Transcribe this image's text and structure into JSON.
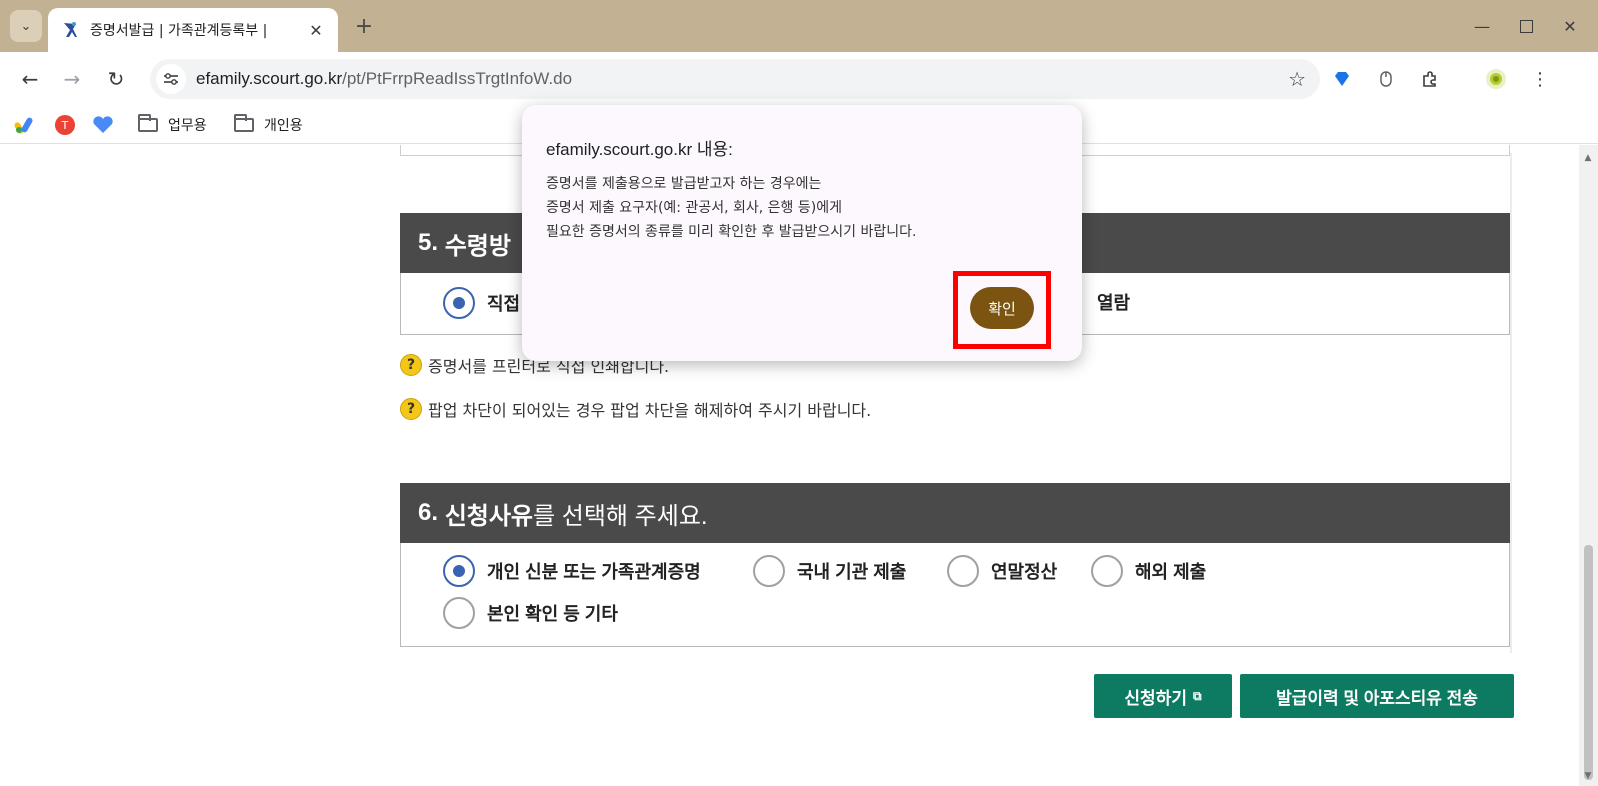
{
  "browser": {
    "tab_title": "증명서발급 | 가족관계등록부 |",
    "url_host": "efamily.scourt.go.kr",
    "url_path": "/pt/PtFrrpReadIssTrgtInfoW.do",
    "bookmarks": [
      "업무용",
      "개인용"
    ]
  },
  "section5": {
    "header_number": "5.",
    "header_bold": "수령방",
    "option_selected": "직접",
    "option_other": "열람"
  },
  "notes": [
    "증명서를 프린터로 직접 인쇄합니다.",
    "팝업 차단이 되어있는 경우 팝업 차단을 해제하여 주시기 바랍니다."
  ],
  "section6": {
    "header_number": "6.",
    "header_bold": "신청사유",
    "header_rest": "를 선택해 주세요.",
    "options": [
      "개인 신분 또는 가족관계증명",
      "국내 기관 제출",
      "연말정산",
      "해외 제출",
      "본인 확인 등 기타"
    ],
    "selected_index": 0
  },
  "actions": {
    "apply_label": "신청하기",
    "history_label": "발급이력 및 아포스티유 전송"
  },
  "dialog": {
    "title": "efamily.scourt.go.kr 내용:",
    "lines": [
      "증명서를 제출용으로 발급받고자 하는 경우에는",
      "증명서 제출 요구자(예: 관공서, 회사, 은행 등)에게",
      "필요한 증명서의 종류를 미리 확인한 후 발급받으시기 바랍니다."
    ],
    "ok_label": "확인"
  },
  "colors": {
    "tabstrip": "#c2b193",
    "section_header": "#4a4a4a",
    "primary_button": "#0d7b62",
    "dialog_ok": "#7a5410",
    "highlight": "#ff0000",
    "radio_selected": "#3a64b0"
  }
}
